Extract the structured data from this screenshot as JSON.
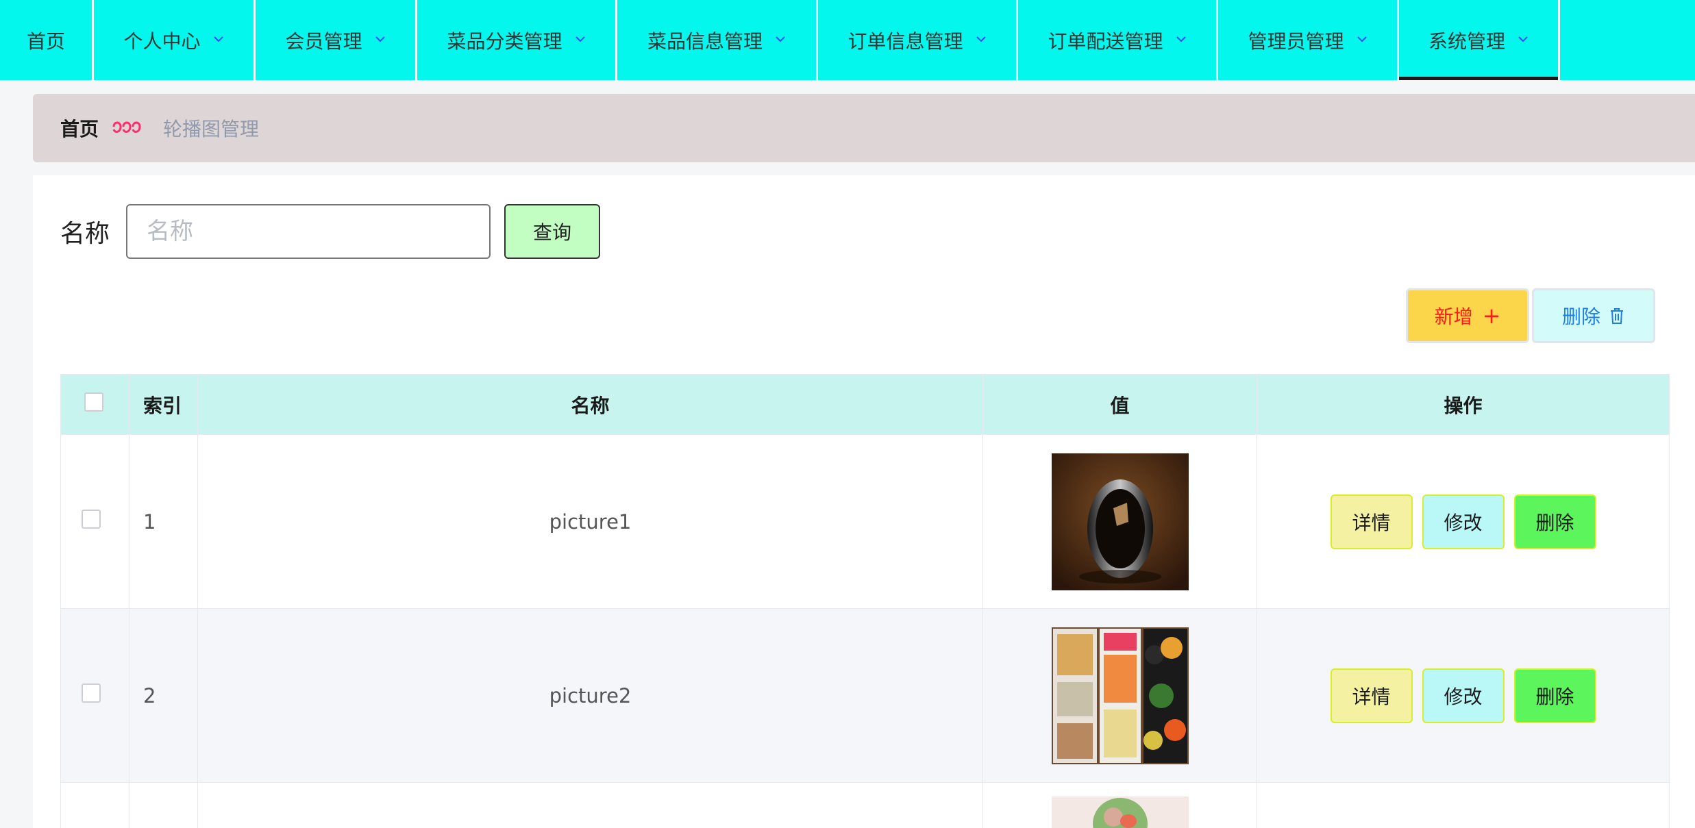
{
  "nav": {
    "items": [
      {
        "label": "首页",
        "dropdown": false,
        "active": false
      },
      {
        "label": "个人中心",
        "dropdown": true,
        "active": false
      },
      {
        "label": "会员管理",
        "dropdown": true,
        "active": false
      },
      {
        "label": "菜品分类管理",
        "dropdown": true,
        "active": false
      },
      {
        "label": "菜品信息管理",
        "dropdown": true,
        "active": false
      },
      {
        "label": "订单信息管理",
        "dropdown": true,
        "active": false
      },
      {
        "label": "订单配送管理",
        "dropdown": true,
        "active": false
      },
      {
        "label": "管理员管理",
        "dropdown": true,
        "active": false
      },
      {
        "label": "系统管理",
        "dropdown": true,
        "active": true
      }
    ]
  },
  "breadcrumb": {
    "home": "首页",
    "current": "轮播图管理"
  },
  "search": {
    "label": "名称",
    "placeholder": "名称",
    "value": "",
    "query_label": "查询"
  },
  "actions": {
    "add_label": "新增",
    "delete_label": "删除"
  },
  "table": {
    "headers": {
      "index": "索引",
      "name": "名称",
      "value": "值",
      "ops": "操作"
    },
    "op_labels": {
      "detail": "详情",
      "edit": "修改",
      "delete": "删除"
    },
    "rows": [
      {
        "index": "1",
        "name": "picture1",
        "image": "coffee-cup-photo",
        "highlighted": true
      },
      {
        "index": "2",
        "name": "picture2",
        "image": "food-platter-photo",
        "highlighted": false
      },
      {
        "index": "",
        "name": "",
        "image": "salad-photo",
        "highlighted": false
      }
    ]
  },
  "colors": {
    "nav_bg": "#04f7ec",
    "breadcrumb_bg": "#ded6d6",
    "table_header_bg": "#c8f4f0",
    "add_btn": "#fcd64a",
    "delete_btn": "#d2fbfa",
    "detail_btn": "#f4f2a2",
    "edit_btn": "#b9f8f7",
    "row_delete_btn": "#5cf55c",
    "link_blue": "#1a82e0"
  }
}
